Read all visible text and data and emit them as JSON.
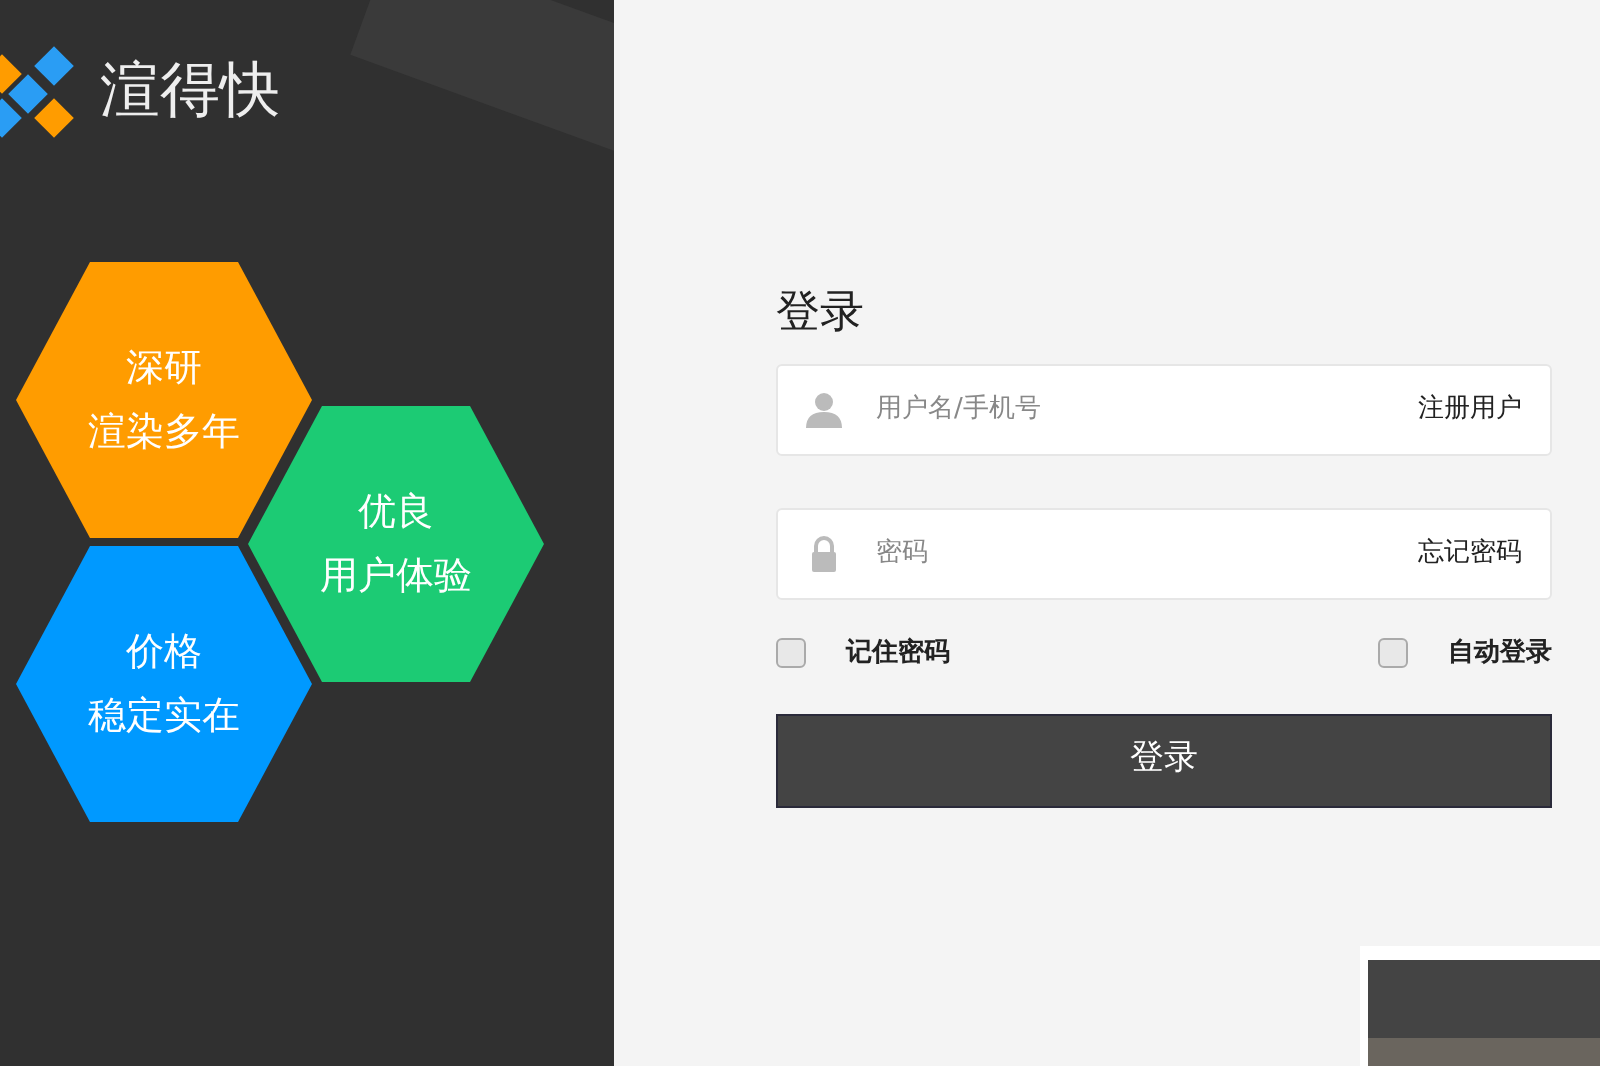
{
  "brand": {
    "name": "渲得快"
  },
  "features": [
    {
      "lines": [
        "深研",
        "渲染多年"
      ],
      "color": "#ff9c00"
    },
    {
      "lines": [
        "优良",
        "用户体验"
      ],
      "color": "#1ccb74"
    },
    {
      "lines": [
        "价格",
        "稳定实在"
      ],
      "color": "#0099ff"
    }
  ],
  "login": {
    "title": "登录",
    "username": {
      "placeholder": "用户名/手机号",
      "link": "注册用户"
    },
    "password": {
      "placeholder": "密码",
      "link": "忘记密码"
    },
    "options": [
      {
        "label": "记住密码",
        "checked": false
      },
      {
        "label": "自动登录",
        "checked": false
      }
    ],
    "submit": "登录"
  }
}
